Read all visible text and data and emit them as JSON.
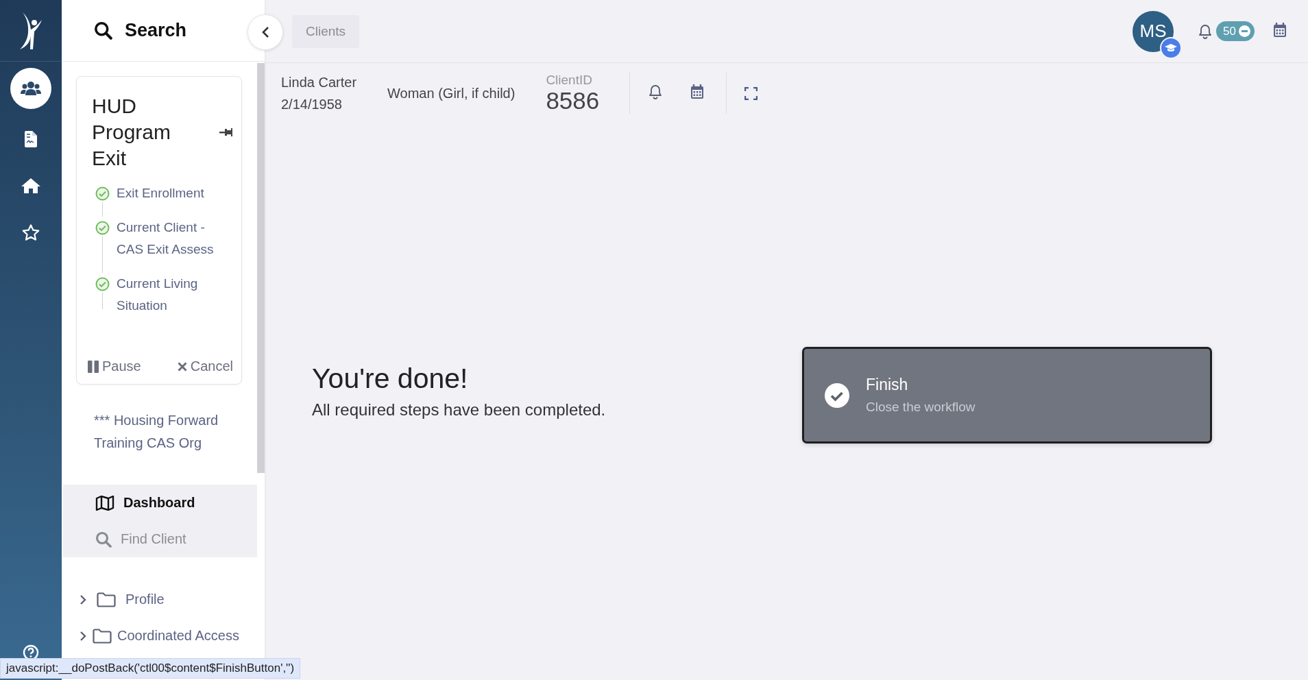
{
  "rail": {
    "items": [
      {
        "kind": "people",
        "selected": true
      },
      {
        "kind": "document",
        "selected": false
      },
      {
        "kind": "home",
        "selected": false
      },
      {
        "kind": "star",
        "selected": false
      }
    ]
  },
  "sidebar": {
    "search_label": "Search",
    "workflow": {
      "title": "HUD Program Exit",
      "steps": [
        {
          "label": "Exit Enrollment",
          "done": true
        },
        {
          "label": "Current Client - CAS Exit Assess",
          "done": true
        },
        {
          "label": "Current Living Situation",
          "done": true
        }
      ],
      "actions": [
        {
          "kind": "pause",
          "label": "Pause"
        },
        {
          "kind": "cancel",
          "label": "Cancel"
        }
      ]
    },
    "organization": "*** Housing Forward Training CAS Org",
    "nav": [
      {
        "kind": "map",
        "label": "Dashboard",
        "selected": true
      },
      {
        "kind": "search",
        "label": "Find Client",
        "selected": false
      }
    ],
    "folders": [
      {
        "label": "Profile",
        "expanded": false
      },
      {
        "label": "Coordinated Access",
        "expanded": false
      }
    ]
  },
  "breadcrumb": "Clients",
  "user": {
    "initials": "MS"
  },
  "notifications": {
    "count": "50"
  },
  "client": {
    "name": "Linda Carter",
    "birth_date": "2/14/1958",
    "gender": "Woman (Girl, if child)",
    "id_label": "ClientID",
    "id": "8586"
  },
  "completion": {
    "heading": "You're done!",
    "message": "All required steps have been completed."
  },
  "finish": {
    "title": "Finish",
    "subtitle": "Close the workflow"
  },
  "status_bar": "javascript:__doPostBack('ctl00$content$FinishButton','')"
}
